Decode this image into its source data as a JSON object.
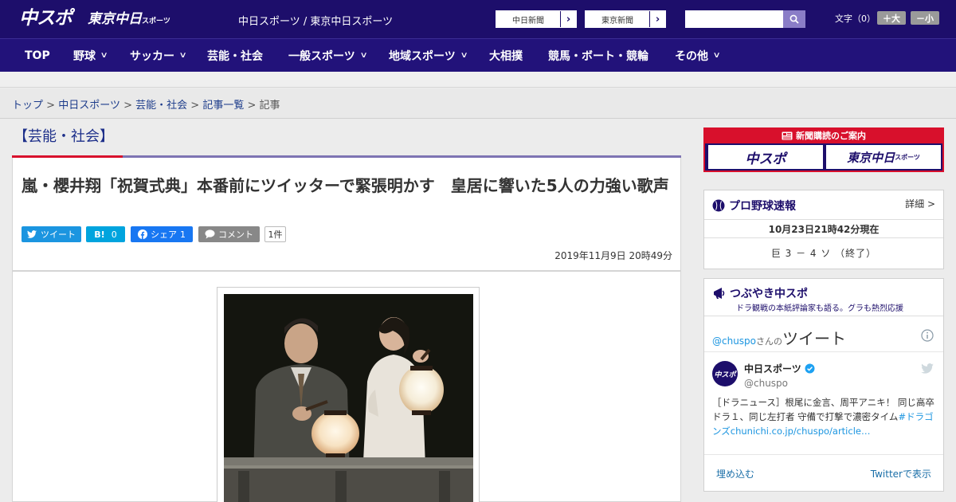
{
  "header": {
    "logo_chuspo": "中スポ",
    "logo_tokyo": "東京中日",
    "logo_tokyo_small": "スポーツ",
    "site_name": "中日スポーツ / 東京中日スポーツ",
    "links": [
      {
        "label": "中日新聞"
      },
      {
        "label": "東京新聞"
      }
    ],
    "search_placeholder": "",
    "font_size_label": "文字（0）",
    "font_plus": "＋大",
    "font_minus": "－小"
  },
  "nav": {
    "items": [
      {
        "label": "TOP",
        "has_menu": false
      },
      {
        "label": "野球",
        "has_menu": true
      },
      {
        "label": "サッカー",
        "has_menu": true
      },
      {
        "label": "芸能・社会",
        "has_menu": false
      },
      {
        "label": "一般スポーツ",
        "has_menu": true
      },
      {
        "label": "地域スポーツ",
        "has_menu": true
      },
      {
        "label": "大相撲",
        "has_menu": false
      },
      {
        "label": "競馬・ボート・競輪",
        "has_menu": false
      },
      {
        "label": "その他",
        "has_menu": true
      }
    ],
    "chevron": "∨"
  },
  "breadcrumb": {
    "items": [
      "トップ",
      "中日スポーツ",
      "芸能・社会",
      "記事一覧"
    ],
    "current": "記事",
    "separator": ">"
  },
  "article": {
    "category": "【芸能・社会】",
    "headline": "嵐・櫻井翔「祝賀式典」本番前にツイッターで緊張明かす　皇居に響いた5人の力強い歌声",
    "share": {
      "tweet": "ツイート",
      "hatena": "B!",
      "hatena_count": "0",
      "facebook": "シェア",
      "facebook_count": "1",
      "comment": "コメント",
      "comment_count": "1件"
    },
    "date": "2019年11月9日 20時49分"
  },
  "sidebar": {
    "subscribe": {
      "title": "新聞購読のご案内",
      "chuspo": "中スポ",
      "tokyo": "東京中日",
      "tokyo_small": "スポーツ"
    },
    "baseball": {
      "title": "プロ野球速報",
      "detail": "詳細 >",
      "updated": "10月23日21時42分現在",
      "score": "巨 3 － 4 ソ （終了）"
    },
    "tweets": {
      "title": "つぶやき中スポ",
      "subtitle": "ドラ観戦の本紙評論家も語る。グラも熱烈応援",
      "handle_prefix": "@chuspo",
      "handle_suffix": "さんの",
      "tweets_label": "ツイート",
      "user_name": "中日スポーツ",
      "user_handle": "@chuspo",
      "tweet_text": "［ドラニュース］根尾に金言、周平アニキ！ 同じ高卒ドラ１、同じ左打者 守備で打撃で濃密タイム",
      "tweet_link": "#ドラゴンズchunichi.co.jp/chuspo/article…",
      "embed": "埋め込む",
      "view_on_twitter": "Twitterで表示"
    }
  },
  "colors": {
    "header_bg": "#1d0e6b",
    "nav_bg": "#22127a",
    "accent_red": "#d8102c",
    "twitter_blue": "#1b95e0",
    "facebook_blue": "#1877f2",
    "hatena_blue": "#00a4de"
  }
}
